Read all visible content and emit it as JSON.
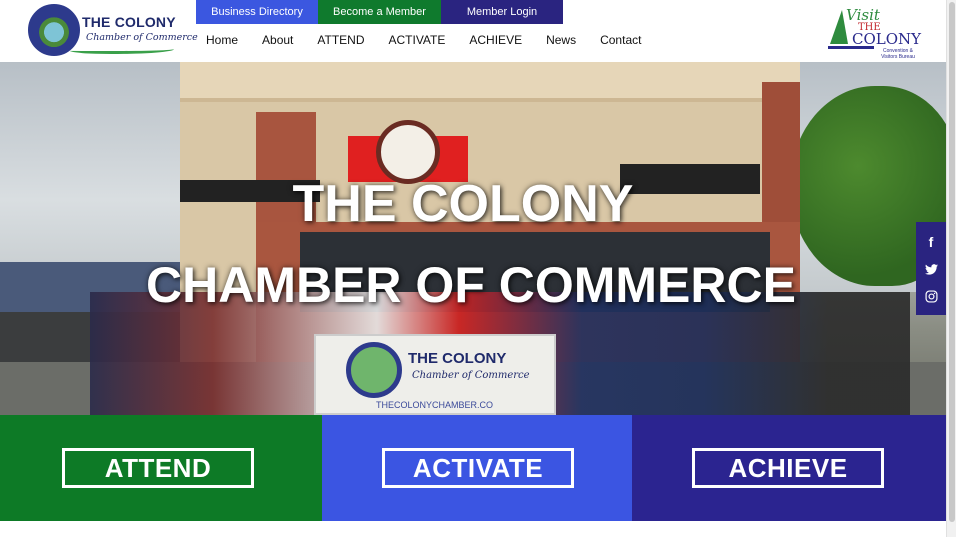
{
  "header": {
    "logo": {
      "title": "THE COLONY",
      "subtitle": "Chamber of Commerce"
    },
    "top_buttons": [
      "Business Directory",
      "Become a Member",
      "Member Login"
    ],
    "nav": [
      "Home",
      "About",
      "ATTEND",
      "ACTIVATE",
      "ACHIEVE",
      "News",
      "Contact"
    ],
    "visit_logo": {
      "line1": "Visit",
      "line2": "THE",
      "line3": "COLONY",
      "line4": "Convention & Visitors Bureau"
    }
  },
  "hero": {
    "title_line1": "THE COLONY",
    "title_line2": "CHAMBER OF COMMERCE",
    "banner": {
      "title": "THE COLONY",
      "subtitle": "Chamber of Commerce",
      "url": "THECOLONYCHAMBER.CO"
    }
  },
  "social": [
    "facebook-icon",
    "twitter-icon",
    "instagram-icon"
  ],
  "bands": [
    {
      "label": "ATTEND",
      "color": "#0d7a26"
    },
    {
      "label": "ACTIVATE",
      "color": "#3b55e2"
    },
    {
      "label": "ACHIEVE",
      "color": "#2b2490"
    }
  ]
}
